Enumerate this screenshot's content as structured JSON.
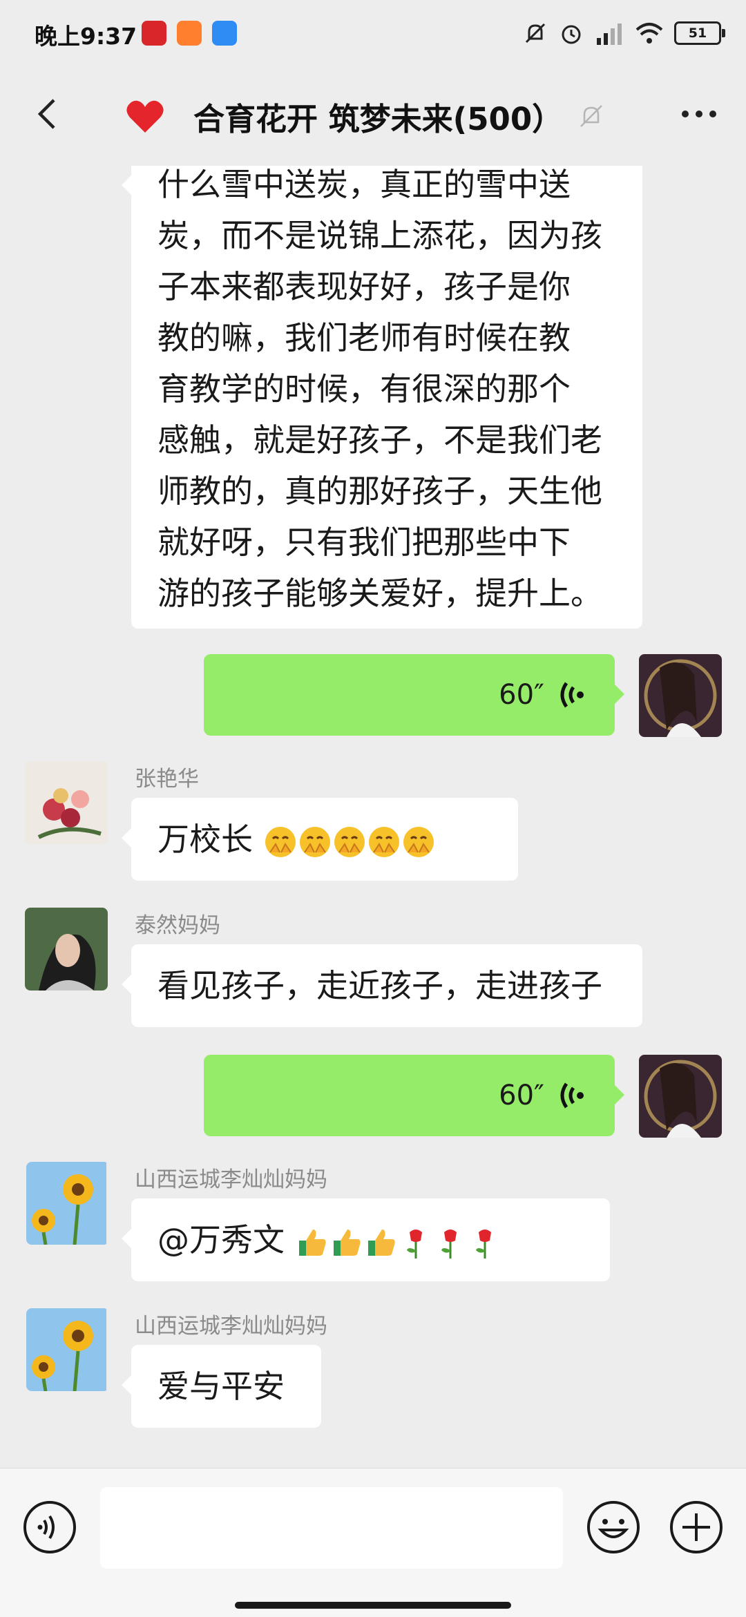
{
  "status": {
    "time": "晚上9:37",
    "battery": "51"
  },
  "header": {
    "title": "合育花开 筑梦未来(500）"
  },
  "messages": {
    "m1": {
      "lines": [
        "什么雪中送炭，真正的雪中送",
        "炭，而不是说锦上添花，因为孩",
        "子本来都表现好好，孩子是你",
        "教的嘛，我们老师有时候在教",
        "育教学的时候，有很深的那个",
        "感触，就是好孩子，不是我们老",
        "师教的，真的那好孩子，天生他",
        "就好呀，只有我们把那些中下",
        "游的孩子能够关爱好，提升上。"
      ]
    },
    "m2": {
      "duration": "60″"
    },
    "m3": {
      "sender": "张艳华",
      "text": "万校长"
    },
    "m4": {
      "sender": "泰然妈妈",
      "text": "看见孩子，走近孩子，走进孩子"
    },
    "m5": {
      "duration": "60″"
    },
    "m6": {
      "sender": "山西运城李灿灿妈妈",
      "text": "@万秀文 "
    },
    "m7": {
      "sender": "山西运城李灿灿妈妈",
      "text": "爱与平安"
    }
  },
  "input": {
    "placeholder": ""
  },
  "colors": {
    "self_bubble": "#95ec69",
    "other_bubble": "#ffffff",
    "background": "#ededed"
  }
}
